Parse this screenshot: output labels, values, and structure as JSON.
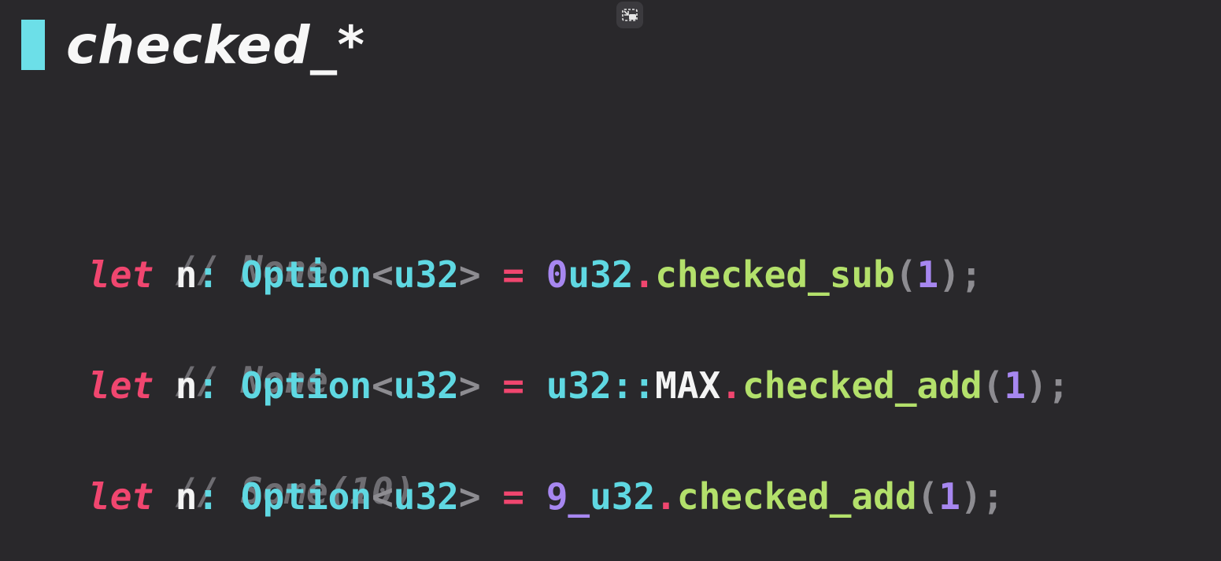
{
  "slide": {
    "title": "checked_*"
  },
  "code": {
    "lines": [
      {
        "kind": "comment",
        "text": "// None"
      },
      {
        "kind": "code",
        "kw": "let",
        "var": "n",
        "colon": ":",
        "type": "Option",
        "lt": "<",
        "type_arg": "u32",
        "gt": ">",
        "eq": "=",
        "receiver_num": "0",
        "receiver_type": "u32",
        "receiver_sep": "",
        "receiver_const": "",
        "dot": ".",
        "method": "checked_sub",
        "lparen": "(",
        "arg": "1",
        "rparen": ")",
        "semi": ";"
      },
      {
        "kind": "comment",
        "text": "// None"
      },
      {
        "kind": "code",
        "kw": "let",
        "var": "n",
        "colon": ":",
        "type": "Option",
        "lt": "<",
        "type_arg": "u32",
        "gt": ">",
        "eq": "=",
        "receiver_num": "",
        "receiver_type": "u32",
        "receiver_sep": "::",
        "receiver_const": "MAX",
        "dot": ".",
        "method": "checked_add",
        "lparen": "(",
        "arg": "1",
        "rparen": ")",
        "semi": ";"
      },
      {
        "kind": "comment",
        "text": "// Some(10)"
      },
      {
        "kind": "code",
        "kw": "let",
        "var": "n",
        "colon": ":",
        "type": "Option",
        "lt": "<",
        "type_arg": "u32",
        "gt": ">",
        "eq": "=",
        "receiver_num": "9_",
        "receiver_type": "u32",
        "receiver_sep": "",
        "receiver_const": "",
        "dot": ".",
        "method": "checked_add",
        "lparen": "(",
        "arg": "1",
        "rparen": ")",
        "semi": ";"
      }
    ]
  },
  "icons": {
    "pip": "picture-in-picture-exit-icon"
  },
  "colors": {
    "background": "#29282b",
    "accent": "#6cdfe8",
    "keyword": "#f0466f",
    "type": "#5fd8e2",
    "number": "#a787f0",
    "method": "#b3e06b",
    "comment": "#6e6d72"
  }
}
